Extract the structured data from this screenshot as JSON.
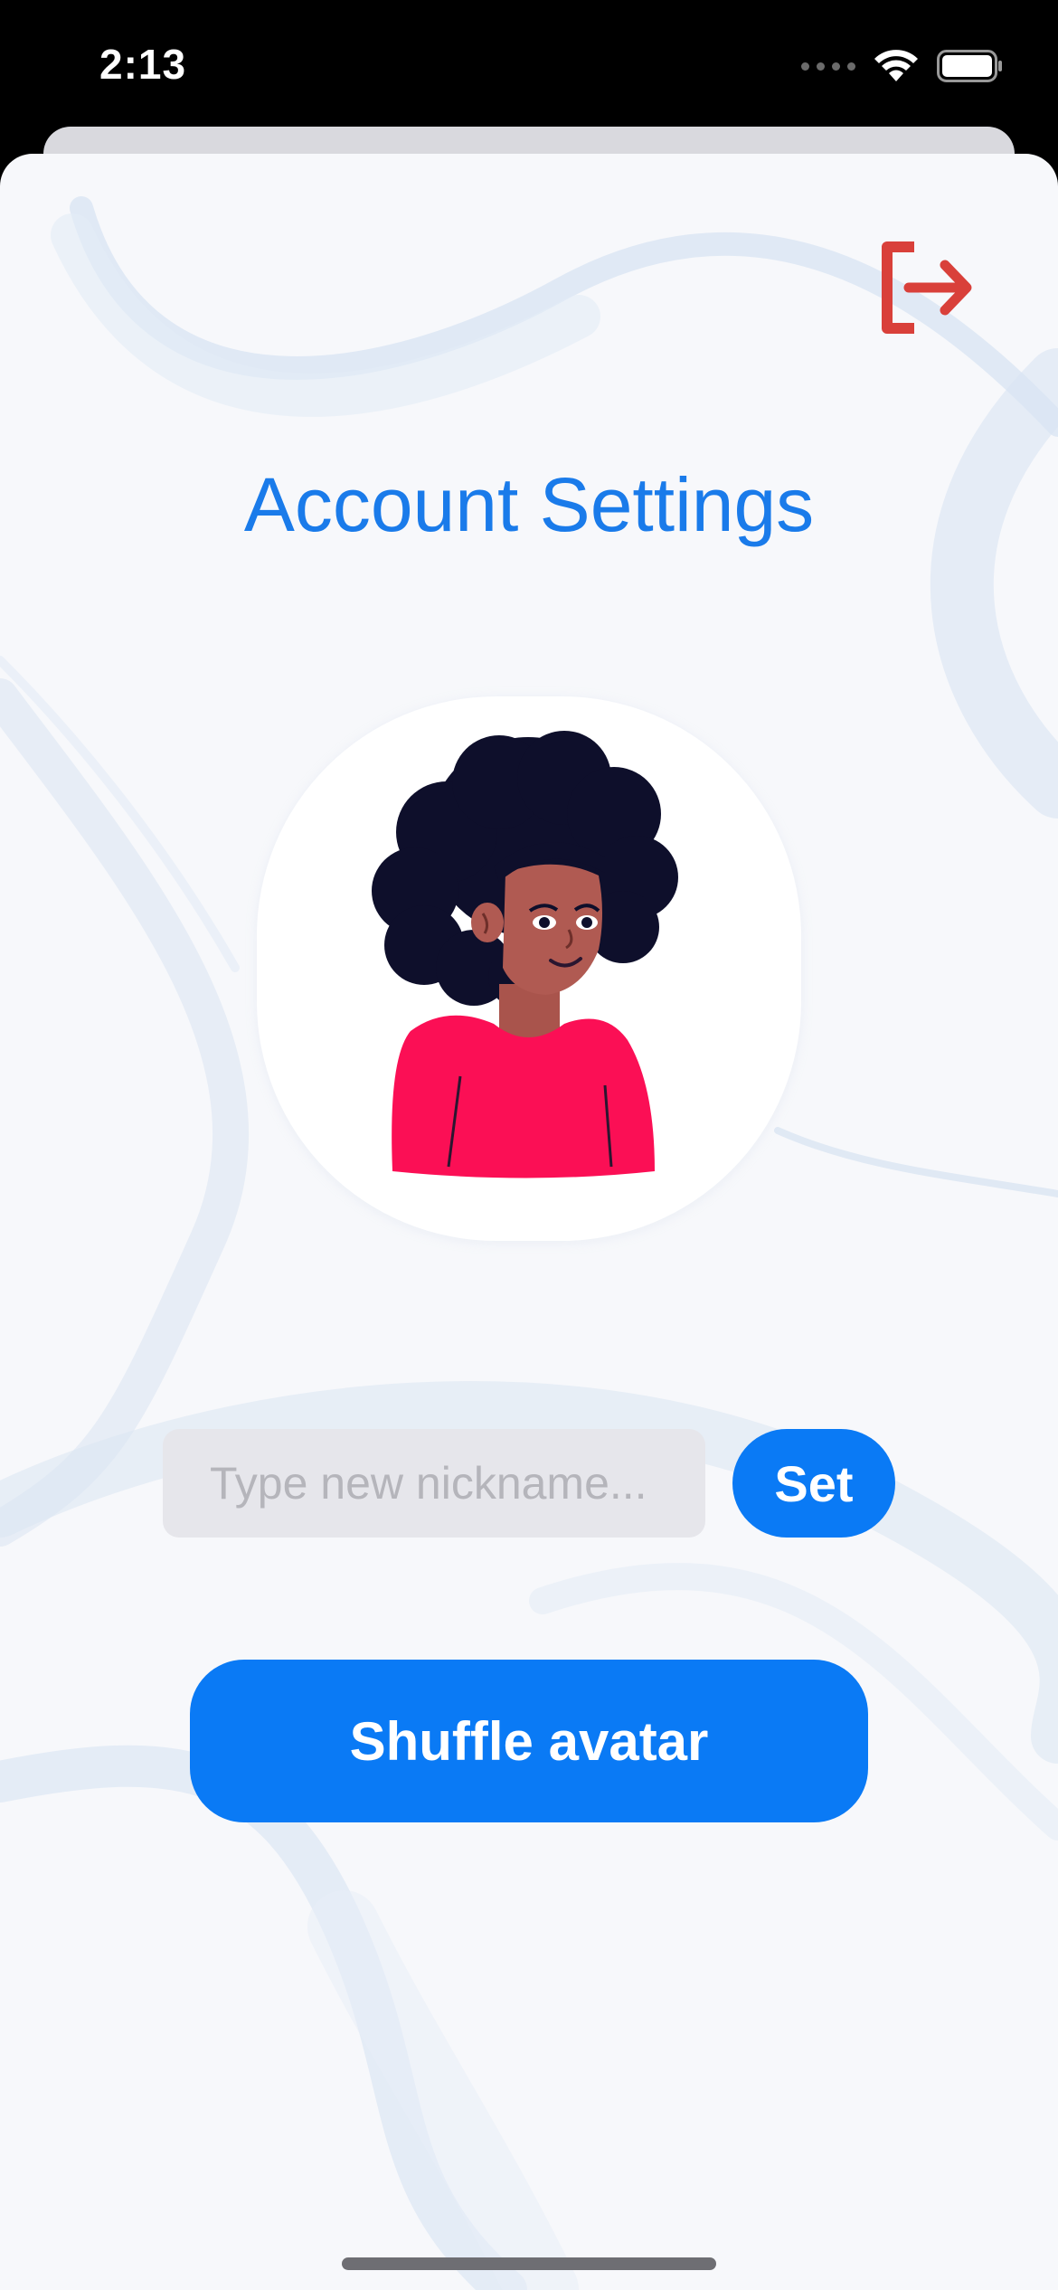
{
  "status_bar": {
    "time": "2:13",
    "icons": [
      "signal-dots-icon",
      "wifi-icon",
      "battery-icon"
    ]
  },
  "header": {
    "logout_icon": "logout-icon",
    "logout_color": "#d9403a"
  },
  "main": {
    "title": "Account Settings",
    "title_color": "#1a7bea",
    "avatar_icon": "avatar-woman-afro-icon",
    "nickname": {
      "value": "",
      "placeholder": "Type new nickname..."
    },
    "set_label": "Set",
    "shuffle_label": "Shuffle avatar",
    "accent_color": "#0a7af5"
  }
}
